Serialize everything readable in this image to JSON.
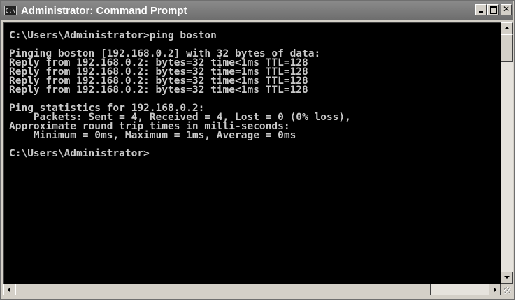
{
  "window": {
    "title": "Administrator: Command Prompt",
    "icon_label": "C:\\",
    "controls": {
      "minimize": "minimize-icon",
      "maximize": "maximize-icon",
      "close": "close-icon"
    }
  },
  "console": {
    "lines": [
      "C:\\Users\\Administrator>ping boston",
      "",
      "Pinging boston [192.168.0.2] with 32 bytes of data:",
      "Reply from 192.168.0.2: bytes=32 time<1ms TTL=128",
      "Reply from 192.168.0.2: bytes=32 time=1ms TTL=128",
      "Reply from 192.168.0.2: bytes=32 time<1ms TTL=128",
      "Reply from 192.168.0.2: bytes=32 time<1ms TTL=128",
      "",
      "Ping statistics for 192.168.0.2:",
      "    Packets: Sent = 4, Received = 4, Lost = 0 (0% loss),",
      "Approximate round trip times in milli-seconds:",
      "    Minimum = 0ms, Maximum = 1ms, Average = 0ms",
      "",
      "C:\\Users\\Administrator>"
    ],
    "text_color": "#c9c9c9",
    "background": "#000000"
  },
  "colors": {
    "titlebar": "#7a7a7a",
    "chrome": "#d4d0c8"
  }
}
